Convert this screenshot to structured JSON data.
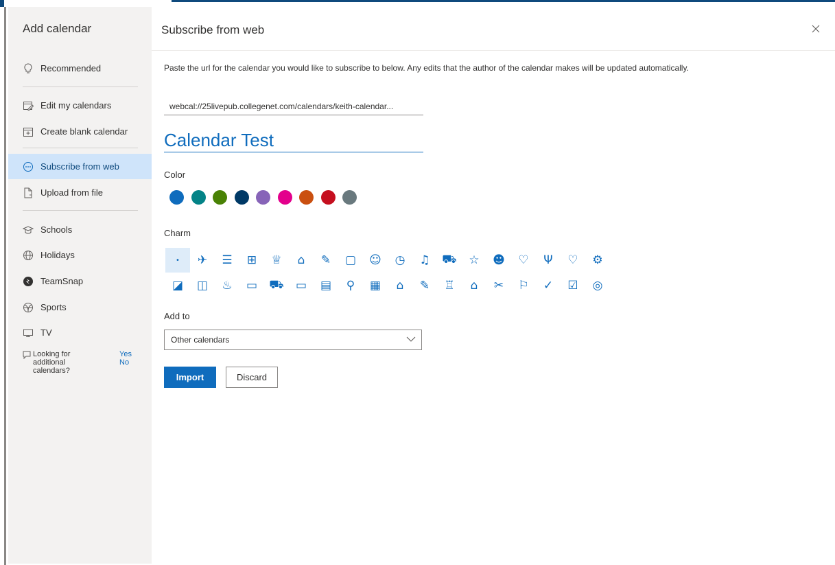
{
  "sidebar": {
    "title": "Add calendar",
    "items": [
      {
        "label": "Recommended",
        "icon": "lightbulb-icon"
      },
      {
        "label": "Edit my calendars",
        "icon": "edit-calendar-icon"
      },
      {
        "label": "Create blank calendar",
        "icon": "add-calendar-icon"
      },
      {
        "label": "Subscribe from web",
        "icon": "subscribe-web-icon",
        "selected": true
      },
      {
        "label": "Upload from file",
        "icon": "upload-file-icon"
      },
      {
        "label": "Schools",
        "icon": "graduation-cap-icon"
      },
      {
        "label": "Holidays",
        "icon": "globe-icon"
      },
      {
        "label": "TeamSnap",
        "icon": "teamsnap-logo-icon"
      },
      {
        "label": "Sports",
        "icon": "sports-ball-icon"
      },
      {
        "label": "TV",
        "icon": "tv-icon"
      }
    ],
    "feedback": {
      "question": "Looking for additional calendars?",
      "yes": "Yes",
      "no": "No"
    }
  },
  "main": {
    "title": "Subscribe from web",
    "description": "Paste the url for the calendar you would like to subscribe to below. Any edits that the author of the calendar makes will be updated automatically.",
    "url_value": "webcal://25livepub.collegenet.com/calendars/keith-calendar...",
    "calendar_name": "Calendar Test",
    "color_label": "Color",
    "colors": [
      "#0f6cbd",
      "#038387",
      "#498205",
      "#003966",
      "#8764b8",
      "#e3008c",
      "#ca5010",
      "#c50f1f",
      "#69797e"
    ],
    "charm_label": "Charm",
    "charms_row1": [
      "•",
      "✈",
      "☰",
      "⊞",
      "♕",
      "⌂",
      "✎",
      "▢",
      "☺",
      "◷",
      "♫",
      "⛟",
      "☆",
      "☻",
      "♡",
      "Ψ",
      "♡",
      "⚙"
    ],
    "charms_row2": [
      "◪",
      "◫",
      "♨",
      "▭",
      "⛟",
      "▭",
      "▤",
      "⚲",
      "▦",
      "⌂",
      "✎",
      "♖",
      "⌂",
      "✂",
      "⚐",
      "✓",
      "☑",
      "◎"
    ],
    "add_to_label": "Add to",
    "add_to_value": "Other calendars",
    "import_label": "Import",
    "discard_label": "Discard"
  }
}
